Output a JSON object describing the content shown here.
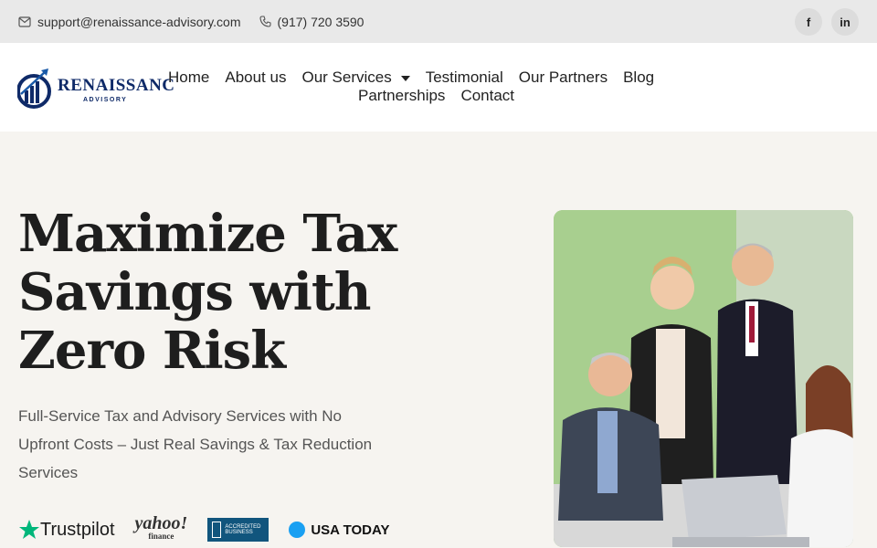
{
  "topbar": {
    "email": "support@renaissance-advisory.com",
    "phone": "(917) 720 3590",
    "social": [
      "f",
      "in"
    ]
  },
  "brand": {
    "name": "RENAISSANC",
    "tagline": "ADVISORY"
  },
  "nav": {
    "items": [
      "Home",
      "About us",
      "Our Services",
      "Testimonial",
      "Our Partners",
      "Blog"
    ],
    "row2": [
      "Partnerships",
      "Contact"
    ]
  },
  "hero": {
    "title_lines": [
      "Maximize Tax",
      "Savings with",
      "Zero Risk"
    ],
    "subtitle": "Full-Service Tax and Advisory Services with No Upfront Costs – Just Real Savings & Tax Reduction Services"
  },
  "badges": {
    "trustpilot": "Trustpilot",
    "yahoo": "yahoo!",
    "yahoo_sub": "finance",
    "bbb": "ACCREDITED BUSINESS",
    "usatoday": "USA TODAY"
  },
  "colors": {
    "brand": "#0f2a68",
    "accent": "#1aa0f2",
    "trustpilot": "#00b67a"
  }
}
